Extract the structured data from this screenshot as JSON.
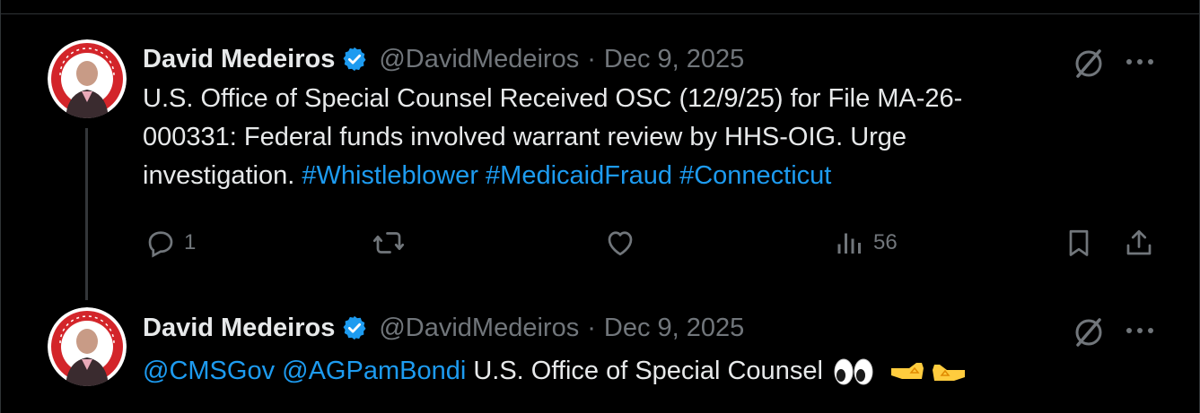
{
  "posts": [
    {
      "author": {
        "display_name": "David Medeiros",
        "handle": "@DavidMedeiros",
        "verified": true,
        "avatar_badge_text": "A.B.I. RESOURCES"
      },
      "separator": "·",
      "date": "Dec 9, 2025",
      "text_line1": "U.S. Office of Special Counsel Received OSC  (12/9/25) for File MA-26-",
      "text_line2": "000331: Federal funds involved warrant review by HHS-OIG. Urge",
      "text_line3_prefix": "investigation.",
      "hashtags": [
        "#Whistleblower",
        "#MedicaidFraud",
        "#Connecticut"
      ],
      "actions": {
        "reply_count": "1",
        "repost_count": "",
        "like_count": "",
        "view_count": "56"
      }
    },
    {
      "author": {
        "display_name": "David Medeiros",
        "handle": "@DavidMedeiros",
        "verified": true
      },
      "separator": "·",
      "date": "Dec 9, 2025",
      "mentions": [
        "@CMSGov",
        "@AGPamBondi"
      ],
      "text": "U.S. Office of Special Counsel"
    }
  ],
  "colors": {
    "background": "#000000",
    "text_primary": "#e7e9ea",
    "text_secondary": "#71767b",
    "link": "#1d9bf0",
    "verified_badge": "#1d9bf0",
    "divider": "#2f3336"
  },
  "icons": [
    "verified-badge-icon",
    "grok-icon",
    "more-icon",
    "reply-icon",
    "repost-icon",
    "like-icon",
    "views-icon",
    "bookmark-icon",
    "share-icon",
    "eyes-emoji",
    "hands-emoji"
  ]
}
